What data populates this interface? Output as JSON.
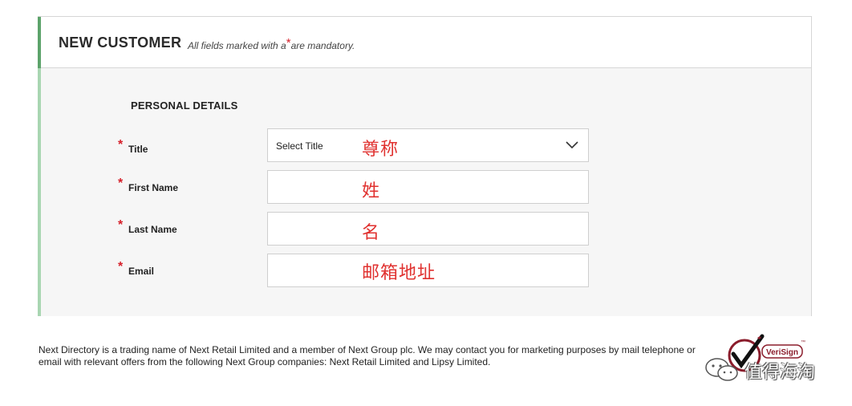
{
  "header": {
    "title": "NEW CUSTOMER",
    "mandatory_prefix": "All fields marked with a",
    "mandatory_star": "*",
    "mandatory_suffix": "are mandatory."
  },
  "section": {
    "title": "PERSONAL DETAILS"
  },
  "fields": [
    {
      "star": "*",
      "label": "Title",
      "value": "Select Title",
      "annotation": "尊称",
      "type": "select"
    },
    {
      "star": "*",
      "label": "First Name",
      "value": "",
      "annotation": "姓",
      "type": "text"
    },
    {
      "star": "*",
      "label": "Last Name",
      "value": "",
      "annotation": "名",
      "type": "text"
    },
    {
      "star": "*",
      "label": "Email",
      "value": "",
      "annotation": "邮箱地址",
      "type": "text"
    }
  ],
  "footer": {
    "text": "Next Directory is a trading name of Next Retail Limited and a member of Next Group plc. We may contact you for marketing purposes by mail telephone or email with relevant offers from the following Next Group companies: Next Retail Limited and Lipsy Limited."
  },
  "badge": {
    "name": "VeriSign",
    "tm": "™"
  },
  "watermark": {
    "text": "值得海淘"
  },
  "colors": {
    "required": "#d6202a",
    "accent": "#5da36b",
    "annotation": "#e0312f"
  }
}
